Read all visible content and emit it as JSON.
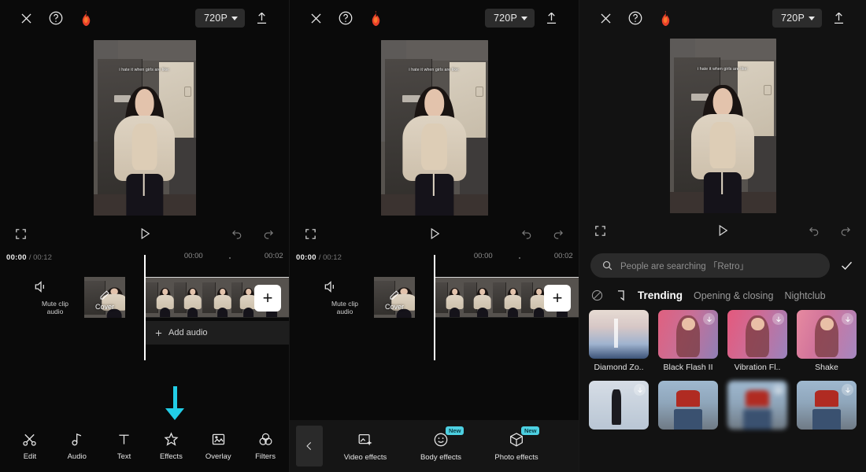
{
  "topbar": {
    "close_icon": "close-icon",
    "help_icon": "help-circle-icon",
    "flame_icon": "flame-icon",
    "resolution_label": "720P",
    "export_icon": "export-upload-icon"
  },
  "preview": {
    "caption": "i hate it when girls are like:",
    "fullscreen_icon": "fullscreen-icon",
    "play_icon": "play-icon",
    "undo_icon": "undo-icon",
    "redo_icon": "redo-icon"
  },
  "timeline": {
    "current_time": "00:00",
    "total_time": "/ 00:12",
    "ruler_ticks": [
      "00:00",
      "00:02"
    ],
    "mute_label": "Mute clip audio",
    "mute_icon": "speaker-mute-icon",
    "cover_label": "Cover",
    "cover_edit_icon": "pencil-icon",
    "add_clip_label": "+",
    "add_audio_label": "Add audio",
    "add_audio_icon": "plus-icon"
  },
  "toolbar_main": {
    "items": [
      {
        "label": "Edit",
        "icon": "scissors-icon"
      },
      {
        "label": "Audio",
        "icon": "music-note-icon"
      },
      {
        "label": "Text",
        "icon": "text-t-icon"
      },
      {
        "label": "Effects",
        "icon": "sparkle-star-icon"
      },
      {
        "label": "Overlay",
        "icon": "picture-frame-icon"
      },
      {
        "label": "Filters",
        "icon": "three-circles-icon"
      }
    ]
  },
  "toolbar_effects": {
    "back_icon": "chevron-left-icon",
    "items": [
      {
        "label": "Video effects",
        "icon": "photo-sparkle-icon",
        "badge": ""
      },
      {
        "label": "Body effects",
        "icon": "smiley-face-icon",
        "badge": "New"
      },
      {
        "label": "Photo effects",
        "icon": "cube-icon",
        "badge": "New"
      }
    ]
  },
  "effects_panel": {
    "search_placeholder": "People are searching 「Retro」",
    "search_icon": "search-icon",
    "confirm_icon": "check-icon",
    "tabs": [
      {
        "label": "",
        "icon": "no-effect-icon",
        "active": false
      },
      {
        "label": "",
        "icon": "bracket-favorites-icon",
        "active": false
      },
      {
        "label": "Trending",
        "icon": "",
        "active": true
      },
      {
        "label": "Opening & closing",
        "icon": "",
        "active": false
      },
      {
        "label": "Nightclub",
        "icon": "",
        "active": false
      }
    ],
    "row1": [
      {
        "label": "Diamond Zo..",
        "download": false,
        "art": "t-city"
      },
      {
        "label": "Black Flash II",
        "download": true,
        "art": "t-pink1 t-girl"
      },
      {
        "label": "Vibration Fl..",
        "download": true,
        "art": "t-pink2 t-girl"
      },
      {
        "label": "Shake",
        "download": true,
        "art": "t-pink3 t-girl"
      }
    ],
    "row2": [
      {
        "label": "",
        "download": true,
        "art": "t-studio"
      },
      {
        "label": "",
        "download": false,
        "art": "t-street"
      },
      {
        "label": "",
        "download": true,
        "art": "t-street t-blur"
      },
      {
        "label": "",
        "download": true,
        "art": "t-street"
      }
    ],
    "download_icon": "download-arrow-icon"
  },
  "annotations": {
    "arrow_color": "#22cde6",
    "arrow1_target": "Effects",
    "arrow2_target": "Body effects"
  }
}
